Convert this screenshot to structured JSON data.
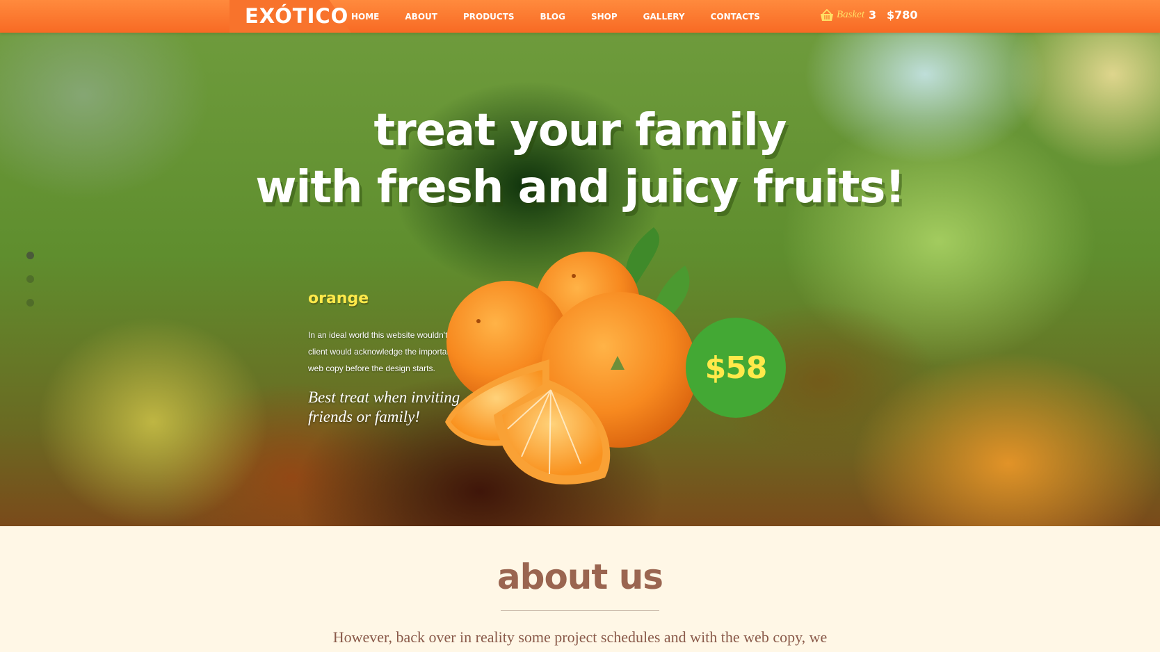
{
  "header": {
    "logo": "EXÓTICO",
    "nav": [
      "HOME",
      "ABOUT",
      "PRODUCTS",
      "BLOG",
      "SHOP",
      "GALLERY",
      "CONTACTS"
    ],
    "basket_label": "Basket",
    "basket_count": "3",
    "basket_total": "$780"
  },
  "hero": {
    "title_line1": "treat your family",
    "title_line2": "with fresh and juicy fruits!",
    "slider_count": 3,
    "active_slide": 1
  },
  "product": {
    "name": "orange",
    "description": "In an ideal world this website wouldn't exist, a client would acknowledge the importance having web copy before the design starts.",
    "tagline": "Best treat when inviting friends or family!",
    "price": "$58"
  },
  "about": {
    "title": "about us",
    "text": "However, back over in reality some project schedules and with the web copy, we"
  },
  "colors": {
    "topbar": "#f86a24",
    "price_badge": "#43a834",
    "accent_yellow": "#ffe94a",
    "about_bg": "#fff7e6",
    "about_title": "#9a6550"
  },
  "icons": [
    "basket-icon"
  ]
}
